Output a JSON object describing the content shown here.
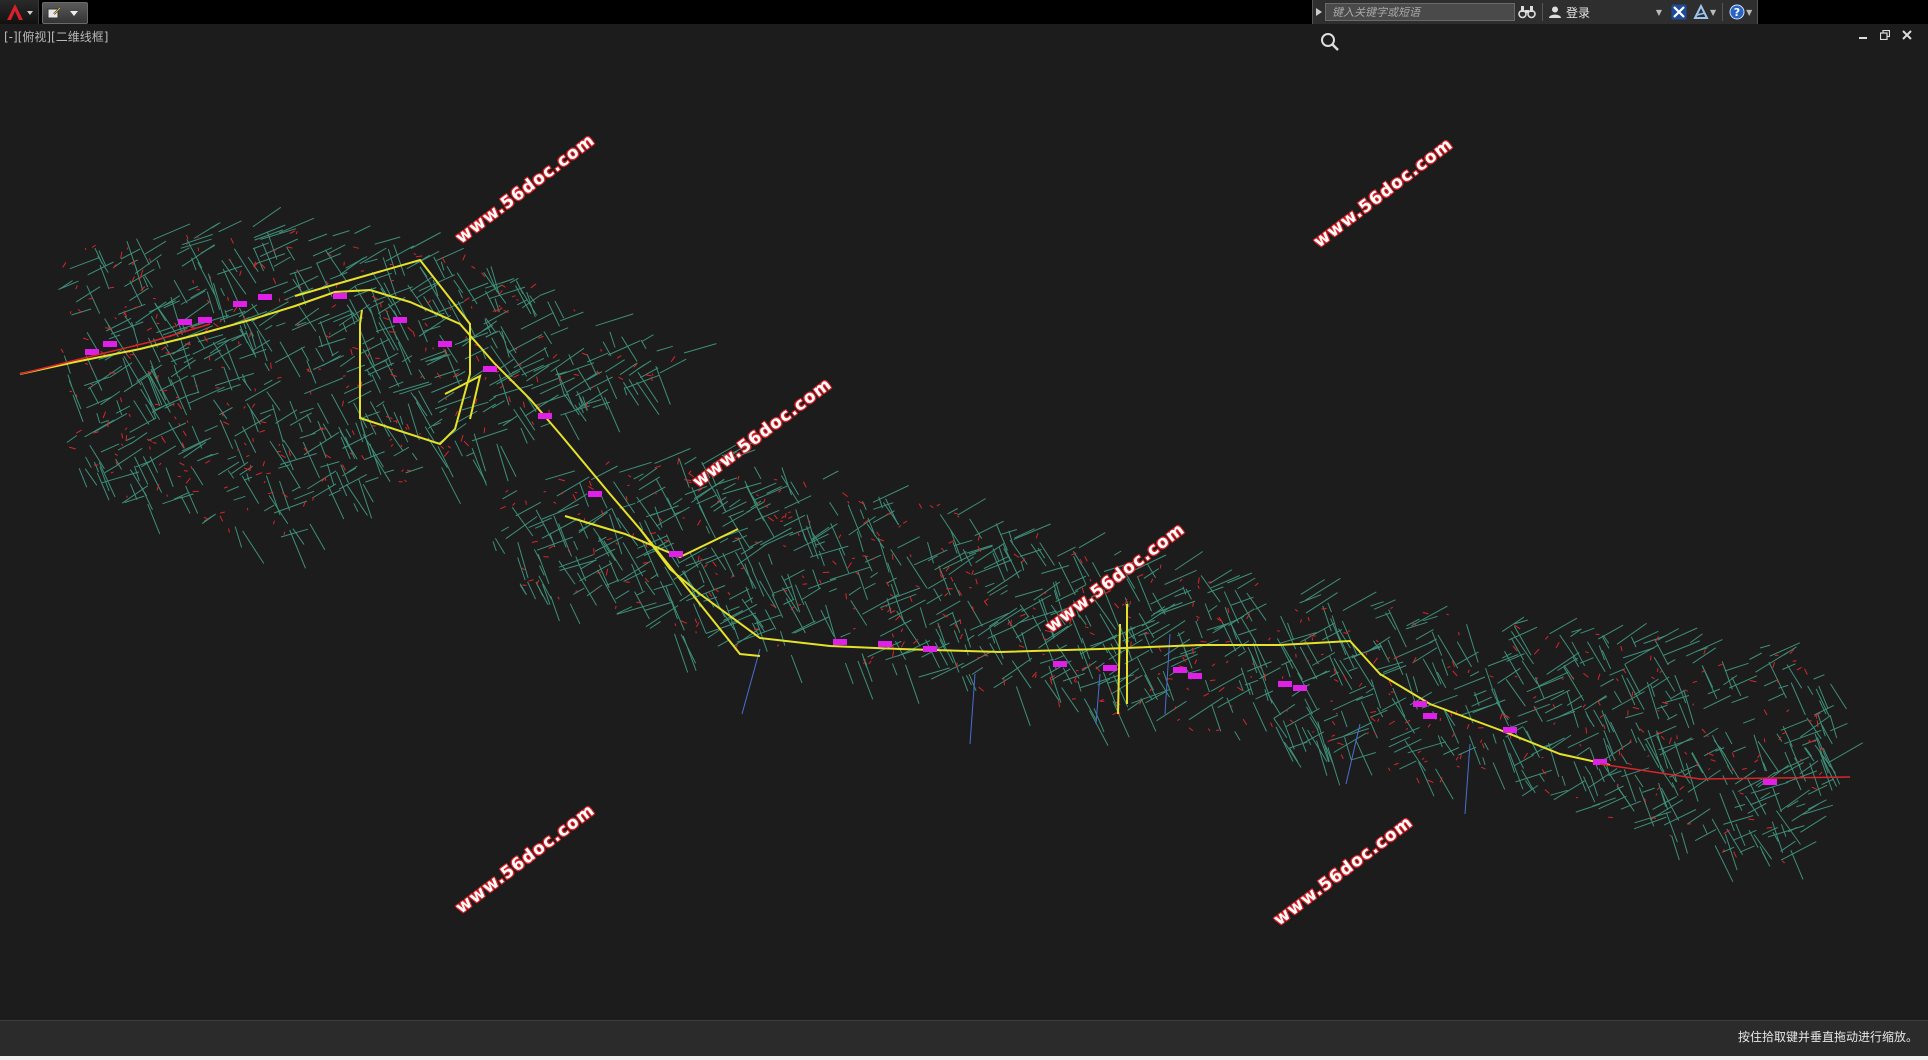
{
  "titlebar": {
    "app_menu_icon": "autocad-logo-icon",
    "quick_access_icon": "workspace-icon"
  },
  "infocenter": {
    "search_placeholder": "键入关键字或短语",
    "binoculars_icon": "binoculars-icon",
    "signin_label": "登录",
    "exchange_icon": "exchange-x-icon",
    "a360_icon": "autodesk-a-icon",
    "help_icon": "help-icon"
  },
  "viewport": {
    "label": "[-][俯视][二维线框]",
    "zoom_cursor_icon": "zoom-magnifier-icon",
    "minimize_icon": "minimize-icon",
    "restore_icon": "restore-icon",
    "close_icon": "close-icon",
    "watermarks": [
      {
        "text": "www.56doc.com"
      },
      {
        "text": "www.56doc.com"
      },
      {
        "text": "www.56doc.com"
      },
      {
        "text": "www.56doc.com"
      },
      {
        "text": "www.56doc.com"
      },
      {
        "text": "www.56doc.com"
      }
    ]
  },
  "statusbar": {
    "prompt": "按住拾取键并垂直拖动进行缩放。"
  },
  "colors": {
    "background": "#1c1c1c",
    "streets": "#3f8f78",
    "red_features": "#d7262b",
    "route": "#e6e22a",
    "stations": "#e020e8",
    "watermark_outline": "#e0242a"
  }
}
